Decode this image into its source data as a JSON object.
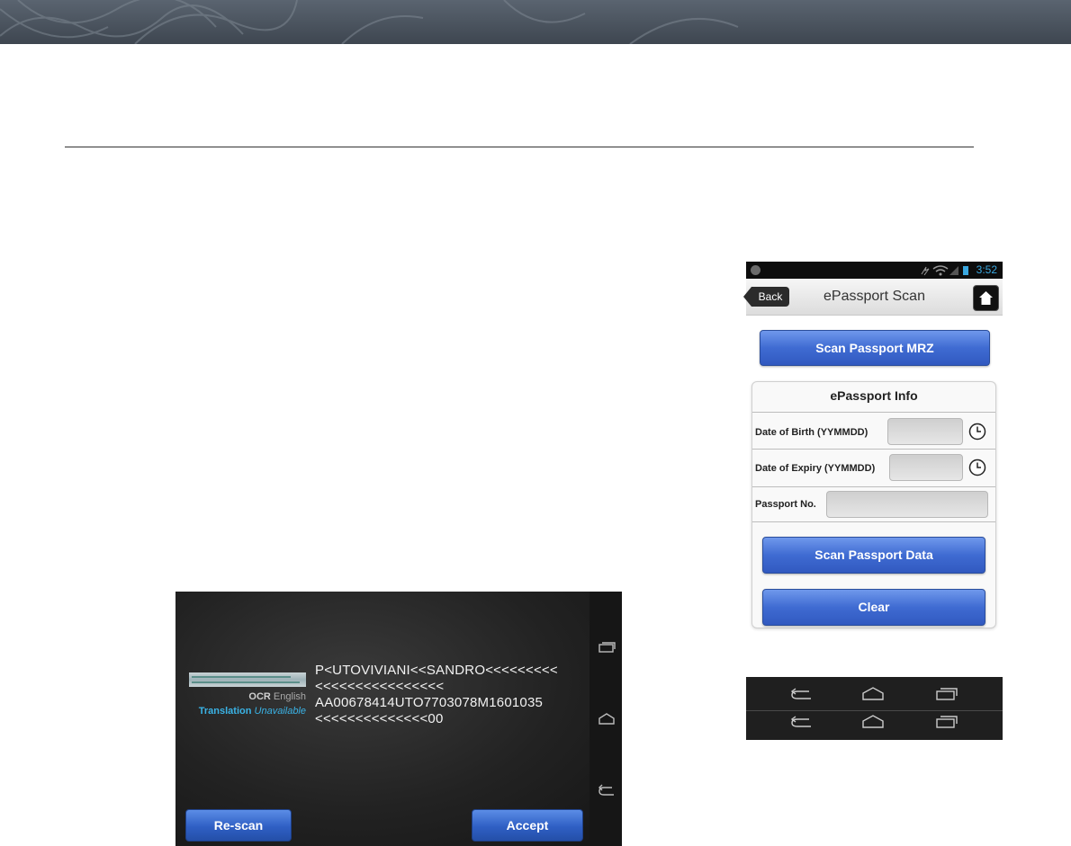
{
  "ocr_screen": {
    "mrz_lines": [
      "P<UTOVIVIANI<<SANDRO<<<<<<<<<",
      "<<<<<<<<<<<<<<<<",
      "AA00678414UTO7703078M1601035",
      "<<<<<<<<<<<<<<00"
    ],
    "ocr_label": "OCR",
    "ocr_value": "English",
    "translation_label": "Translation",
    "translation_value": "Unavailable",
    "rescan_label": "Re-scan",
    "accept_label": "Accept"
  },
  "phone": {
    "status_time": "3:52",
    "back_label": "Back",
    "title": "ePassport Scan",
    "scan_mrz_label": "Scan Passport MRZ",
    "info_title": "ePassport Info",
    "dob_label": "Date of Birth (YYMMDD)",
    "doe_label": "Date of Expiry (YYMMDD)",
    "passport_label": "Passport No.",
    "scan_data_label": "Scan Passport Data",
    "clear_label": "Clear"
  },
  "colors": {
    "button_blue": "#3f6bd2",
    "status_time": "#3aa8e0",
    "translation": "#3ab3e6"
  }
}
